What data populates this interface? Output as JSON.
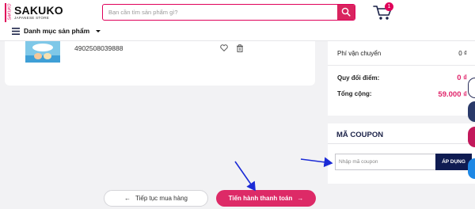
{
  "header": {
    "brand": "SAKUKO",
    "brand_sub": "JAPANESE STORE",
    "brand_side": "SAKUKO",
    "search_placeholder": "Bạn cần tìm sản phẩm gì?",
    "cart_count": "1",
    "category_menu": "Danh mục sản phẩm"
  },
  "product": {
    "sku": "4902508039888"
  },
  "summary": {
    "rows": [
      {
        "label": "Phí vận chuyển",
        "value": "0 ₫"
      },
      {
        "label": "Quy đổi điểm:",
        "value": "0 ₫"
      },
      {
        "label": "Tổng cộng:",
        "value": "59.000 ₫"
      }
    ],
    "accent": "#e0246a"
  },
  "coupon": {
    "title": "MÃ COUPON",
    "placeholder": "Nhập mã coupon",
    "apply": "ÁP DỤNG"
  },
  "actions": {
    "continue": "Tiếp tục mua hàng",
    "checkout": "Tiến hành thanh toán"
  },
  "icons": [
    "menu-icon",
    "search-icon",
    "cart-icon",
    "heart-icon",
    "trash-icon",
    "arrow-left-icon",
    "arrow-right-icon"
  ]
}
